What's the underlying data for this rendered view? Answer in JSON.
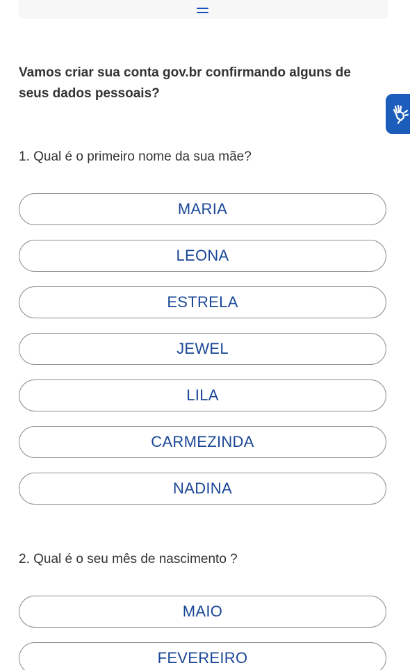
{
  "header": {
    "menu_icon": "menu-icon"
  },
  "intro": {
    "text": "Vamos criar sua conta gov.br confirmando alguns de seus dados pessoais?"
  },
  "accessibility": {
    "icon": "vlibras-hands-icon",
    "color": "#1c5cba"
  },
  "questions": [
    {
      "label": "1. Qual é o primeiro nome da sua mãe?",
      "options": [
        "MARIA",
        "LEONA",
        "ESTRELA",
        "JEWEL",
        "LILA",
        "CARMEZINDA",
        "NADINA"
      ]
    },
    {
      "label": "2. Qual é o seu mês de nascimento ?",
      "options": [
        "MAIO",
        "FEVEREIRO"
      ]
    }
  ],
  "colors": {
    "option_text": "#1a4796",
    "option_border": "#8a8f96",
    "text": "#333333"
  }
}
